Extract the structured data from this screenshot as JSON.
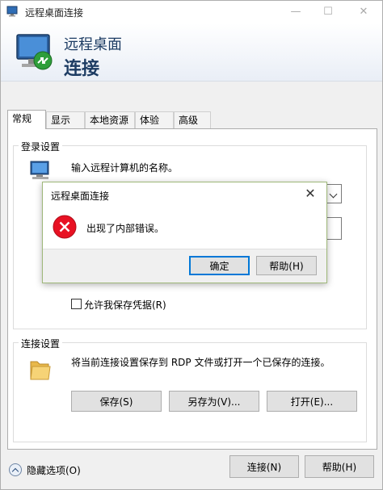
{
  "window": {
    "title": "远程桌面连接",
    "minimize_glyph": "—",
    "maximize_glyph": "☐",
    "close_glyph": "✕"
  },
  "banner": {
    "line1": "远程桌面",
    "line2": "连接"
  },
  "tabs": [
    {
      "label": "常规",
      "active": true
    },
    {
      "label": "显示",
      "active": false
    },
    {
      "label": "本地资源",
      "active": false
    },
    {
      "label": "体验",
      "active": false
    },
    {
      "label": "高级",
      "active": false
    }
  ],
  "login_group": {
    "label": "登录设置",
    "prompt": "输入远程计算机的名称。",
    "save_credentials_label": "允许我保存凭据(R)",
    "save_credentials_checked": false
  },
  "connection_group": {
    "label": "连接设置",
    "description": "将当前连接设置保存到 RDP 文件或打开一个已保存的连接。",
    "save_button": "保存(S)",
    "save_as_button": "另存为(V)...",
    "open_button": "打开(E)..."
  },
  "bottom": {
    "hide_options": "隐藏选项(O)",
    "connect_button": "连接(N)",
    "help_button": "帮助(H)"
  },
  "error_dialog": {
    "title": "远程桌面连接",
    "close_glyph": "✕",
    "message": "出现了内部错误。",
    "ok_button": "确定",
    "help_button": "帮助(H)"
  },
  "colors": {
    "accent": "#0078d7",
    "error_red": "#e81123",
    "banner_text": "#1d3c63"
  }
}
